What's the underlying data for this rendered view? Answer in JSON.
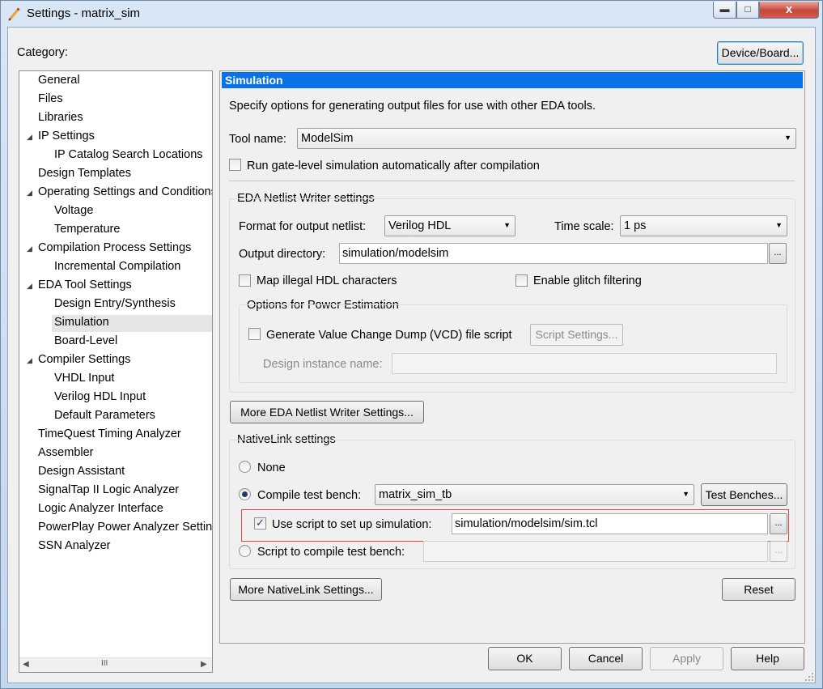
{
  "window": {
    "title": "Settings - matrix_sim",
    "close_glyph": "x"
  },
  "category_label": "Category:",
  "device_board_label": "Device/Board...",
  "tree": {
    "items": [
      {
        "label": "General",
        "indent": 0,
        "arrow": false
      },
      {
        "label": "Files",
        "indent": 0,
        "arrow": false
      },
      {
        "label": "Libraries",
        "indent": 0,
        "arrow": false
      },
      {
        "label": "IP Settings",
        "indent": 0,
        "arrow": true
      },
      {
        "label": "IP Catalog Search Locations",
        "indent": 1,
        "arrow": false
      },
      {
        "label": "Design Templates",
        "indent": 0,
        "arrow": false
      },
      {
        "label": "Operating Settings and Conditions",
        "indent": 0,
        "arrow": true
      },
      {
        "label": "Voltage",
        "indent": 1,
        "arrow": false
      },
      {
        "label": "Temperature",
        "indent": 1,
        "arrow": false
      },
      {
        "label": "Compilation Process Settings",
        "indent": 0,
        "arrow": true
      },
      {
        "label": "Incremental Compilation",
        "indent": 1,
        "arrow": false
      },
      {
        "label": "EDA Tool Settings",
        "indent": 0,
        "arrow": true
      },
      {
        "label": "Design Entry/Synthesis",
        "indent": 1,
        "arrow": false
      },
      {
        "label": "Simulation",
        "indent": 1,
        "arrow": false
      },
      {
        "label": "Board-Level",
        "indent": 1,
        "arrow": false
      },
      {
        "label": "Compiler Settings",
        "indent": 0,
        "arrow": true
      },
      {
        "label": "VHDL Input",
        "indent": 1,
        "arrow": false
      },
      {
        "label": "Verilog HDL Input",
        "indent": 1,
        "arrow": false
      },
      {
        "label": "Default Parameters",
        "indent": 1,
        "arrow": false
      },
      {
        "label": "TimeQuest Timing Analyzer",
        "indent": 0,
        "arrow": false
      },
      {
        "label": "Assembler",
        "indent": 0,
        "arrow": false
      },
      {
        "label": "Design Assistant",
        "indent": 0,
        "arrow": false
      },
      {
        "label": "SignalTap II Logic Analyzer",
        "indent": 0,
        "arrow": false
      },
      {
        "label": "Logic Analyzer Interface",
        "indent": 0,
        "arrow": false
      },
      {
        "label": "PowerPlay Power Analyzer Settings",
        "indent": 0,
        "arrow": false
      },
      {
        "label": "SSN Analyzer",
        "indent": 0,
        "arrow": false
      }
    ],
    "selected": "Simulation",
    "scroll_thumb_glyph": "III"
  },
  "panel": {
    "header": "Simulation",
    "description": "Specify options for generating output files for use with other EDA tools.",
    "tool_name_label": "Tool name:",
    "tool_name_value": "ModelSim",
    "run_gate_level_label": "Run gate-level simulation automatically after compilation",
    "run_gate_level_checked": false,
    "netlist_group_title": "EDA Netlist Writer settings",
    "format_label": "Format for output netlist:",
    "format_value": "Verilog HDL",
    "time_scale_label": "Time scale:",
    "time_scale_value": "1 ps",
    "output_dir_label": "Output directory:",
    "output_dir_value": "simulation/modelsim",
    "browse_label": "...",
    "map_illegal_label": "Map illegal HDL characters",
    "map_illegal_checked": false,
    "glitch_label": "Enable glitch filtering",
    "glitch_checked": false,
    "power_group_title": "Options for Power Estimation",
    "vcd_label": "Generate Value Change Dump (VCD) file script",
    "vcd_checked": false,
    "script_settings_label": "Script Settings...",
    "design_instance_label": "Design instance name:",
    "design_instance_value": "",
    "more_netlist_label": "More EDA Netlist Writer Settings...",
    "nativelink_group_title": "NativeLink settings",
    "none_label": "None",
    "compile_tb_label": "Compile test bench:",
    "compile_tb_value": "matrix_sim_tb",
    "test_benches_label": "Test Benches...",
    "use_script_label": "Use script to set up simulation:",
    "use_script_checked": true,
    "use_script_value": "simulation/modelsim/sim.tcl",
    "script_compile_label": "Script to compile test bench:",
    "script_compile_value": "",
    "selected_nativelink": "compile_tb",
    "more_nativelink_label": "More NativeLink Settings...",
    "reset_label": "Reset"
  },
  "footer": {
    "ok": "OK",
    "cancel": "Cancel",
    "apply": "Apply",
    "help": "Help"
  },
  "colors": {
    "header_bg": "#0a72e8",
    "highlight_border": "#d9494b"
  }
}
